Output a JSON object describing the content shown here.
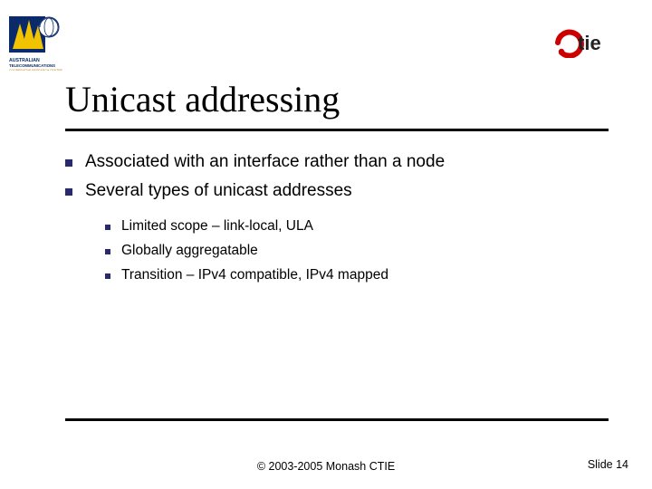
{
  "title": "Unicast addressing",
  "bullets": [
    "Associated with an interface rather than a node",
    "Several types of unicast addresses"
  ],
  "subbullets": [
    "Limited scope – link-local, ULA",
    "Globally aggregatable",
    "Transition – IPv4 compatible, IPv4 mapped"
  ],
  "footer": {
    "copyright": "© 2003-2005 Monash CTIE",
    "slide_label": "Slide 14"
  },
  "logos": {
    "left_alt": "Australian Telecommunications Cooperative Research Centre",
    "right_alt": "CTIE"
  }
}
